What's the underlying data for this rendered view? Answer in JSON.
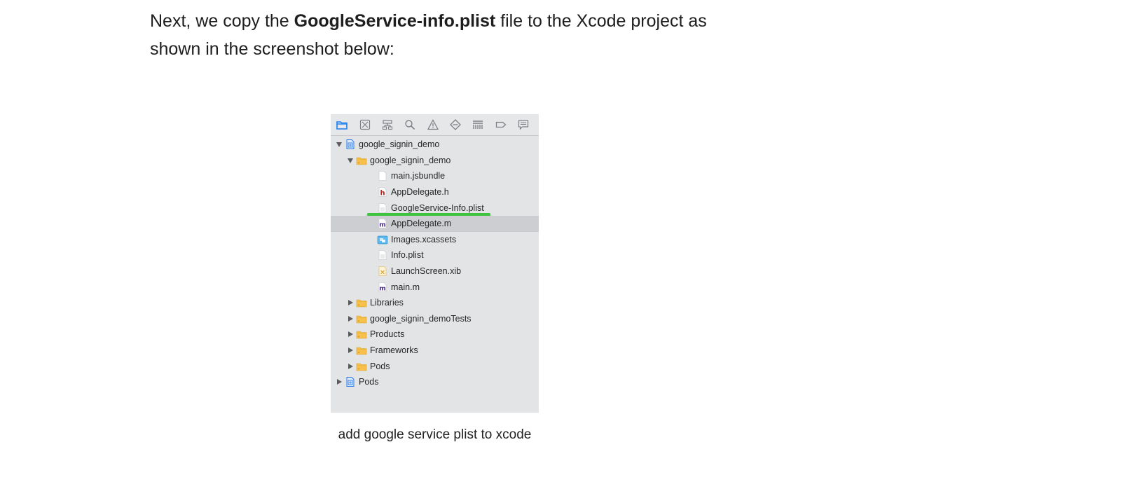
{
  "intro": {
    "before": "Next, we copy the ",
    "bold": "GoogleService-info.plist",
    "after": " file to the Xcode project as shown in the screenshot below:"
  },
  "toolbar": {
    "icons": [
      "folder-icon",
      "source-control-icon",
      "hierarchy-icon",
      "search-icon",
      "warning-icon",
      "test-icon",
      "debug-icon",
      "breakpoint-icon",
      "report-icon"
    ],
    "accent": "#1a7ff0"
  },
  "tree": [
    {
      "label": "google_signin_demo",
      "icon": "project-icon",
      "level": 0,
      "disclosure": "open"
    },
    {
      "label": "google_signin_demo",
      "icon": "folder-icon",
      "level": 1,
      "disclosure": "open"
    },
    {
      "label": "main.jsbundle",
      "icon": "file-icon",
      "level": 2,
      "disclosure": "none"
    },
    {
      "label": "AppDelegate.h",
      "icon": "header-file-icon",
      "level": 2,
      "disclosure": "none"
    },
    {
      "label": "GoogleService-Info.plist",
      "icon": "plist-icon",
      "level": 2,
      "disclosure": "none",
      "highlighted": true
    },
    {
      "label": "AppDelegate.m",
      "icon": "objc-file-icon",
      "level": 2,
      "disclosure": "none",
      "selected": true
    },
    {
      "label": "Images.xcassets",
      "icon": "assets-icon",
      "level": 2,
      "disclosure": "none"
    },
    {
      "label": "Info.plist",
      "icon": "plist-icon",
      "level": 2,
      "disclosure": "none"
    },
    {
      "label": "LaunchScreen.xib",
      "icon": "xib-icon",
      "level": 2,
      "disclosure": "none"
    },
    {
      "label": "main.m",
      "icon": "objc-file-icon",
      "level": 2,
      "disclosure": "none"
    },
    {
      "label": "Libraries",
      "icon": "folder-icon",
      "level": 1,
      "disclosure": "closed"
    },
    {
      "label": "google_signin_demoTests",
      "icon": "folder-icon",
      "level": 1,
      "disclosure": "closed"
    },
    {
      "label": "Products",
      "icon": "folder-icon",
      "level": 1,
      "disclosure": "closed"
    },
    {
      "label": "Frameworks",
      "icon": "folder-icon",
      "level": 1,
      "disclosure": "closed"
    },
    {
      "label": "Pods",
      "icon": "folder-icon",
      "level": 1,
      "disclosure": "closed"
    },
    {
      "label": "Pods",
      "icon": "project-icon",
      "level": 0,
      "disclosure": "closed"
    }
  ],
  "caption": "add google service plist to xcode",
  "colors": {
    "highlight": "#3cc43f",
    "selection": "#cdced1",
    "folder": "#f7c04a"
  }
}
